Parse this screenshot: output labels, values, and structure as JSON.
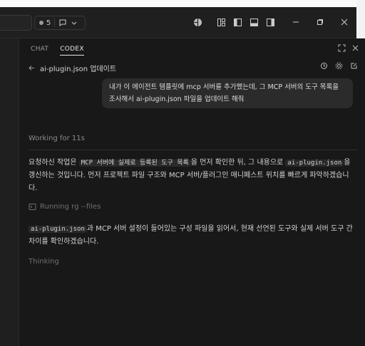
{
  "titlebar": {
    "badge_count": "5"
  },
  "panel": {
    "tabs": [
      {
        "label": "CHAT",
        "active": false
      },
      {
        "label": "CODEX",
        "active": true
      }
    ],
    "breadcrumb": "ai-plugin.json 업데이트",
    "user_message": "내가 이 에이전트 템플릿에 mcp 서버를 추가했는데, 그 MCP 서버의 도구 목록을 조사해서 ai-plugin.json 파일을 업데이트 해줘",
    "working_label": "Working for 11s",
    "para1": {
      "t1": "요청하신 작업은 ",
      "c1": "MCP 서버에 실제로 등록된 도구 목록",
      "t2": "을 먼저 확인한 뒤, 그 내용으로 ",
      "c2": "ai-plugin.json",
      "t3": "을 갱신하는 것입니다. 먼저 프로젝트 파일 구조와 MCP 서버/플러그인 매니페스트 위치를 빠르게 파악하겠습니다."
    },
    "running_label": "Running rg --files",
    "para2": {
      "c1": "ai-plugin.json",
      "t1": "과 MCP 서버 설정이 들어있는 구성 파일을 읽어서, 현재 선언된 도구와 실제 서버 도구 간 차이를 확인하겠습니다."
    },
    "thinking_label": "Thinking"
  }
}
